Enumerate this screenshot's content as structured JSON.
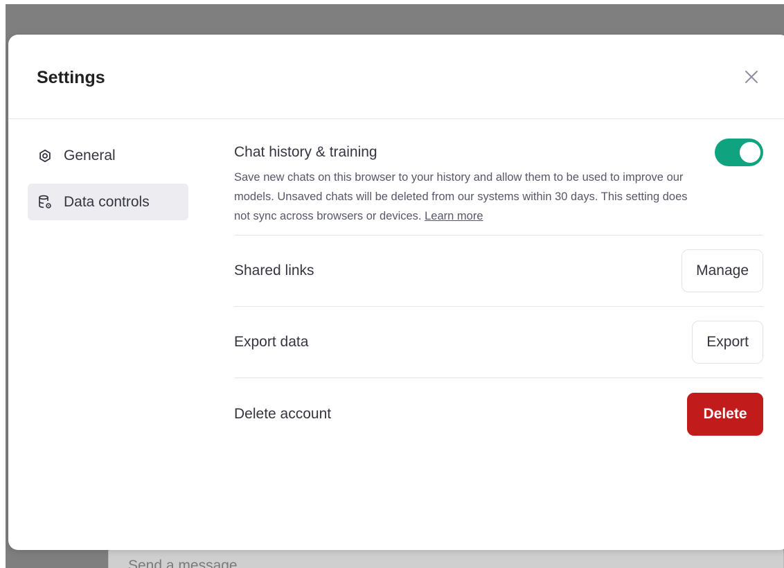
{
  "background": {
    "composer_placeholder": "Send a message"
  },
  "modal": {
    "title": "Settings",
    "close_icon": "close-icon"
  },
  "nav": {
    "items": [
      {
        "label": "General",
        "icon": "gear-icon",
        "active": false
      },
      {
        "label": "Data controls",
        "icon": "database-settings-icon",
        "active": true
      }
    ]
  },
  "data_controls": {
    "chat_history": {
      "title": "Chat history & training",
      "description": "Save new chats on this browser to your history and allow them to be used to improve our models. Unsaved chats will be deleted from our systems within 30 days. This setting does not sync across browsers or devices.",
      "learn_more": "Learn more",
      "enabled": true
    },
    "shared_links": {
      "label": "Shared links",
      "button": "Manage"
    },
    "export_data": {
      "label": "Export data",
      "button": "Export"
    },
    "delete_account": {
      "label": "Delete account",
      "button": "Delete"
    }
  },
  "colors": {
    "toggle_on": "#10a37f",
    "danger": "#c21b1b",
    "overlay": "#7f7f7f"
  }
}
